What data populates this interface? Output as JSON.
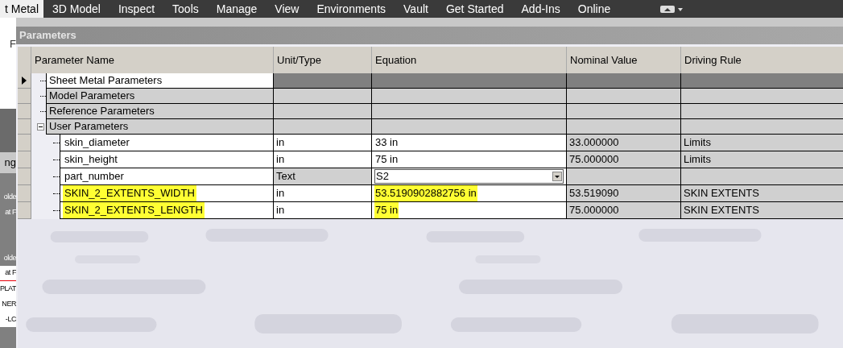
{
  "tabs": [
    {
      "label": "t Metal",
      "selected": true
    },
    {
      "label": "3D Model",
      "selected": false
    },
    {
      "label": "Inspect",
      "selected": false
    },
    {
      "label": "Tools",
      "selected": false
    },
    {
      "label": "Manage",
      "selected": false
    },
    {
      "label": "View",
      "selected": false
    },
    {
      "label": "Environments",
      "selected": false
    },
    {
      "label": "Vault",
      "selected": false
    },
    {
      "label": "Get Started",
      "selected": false
    },
    {
      "label": "Add-Ins",
      "selected": false
    },
    {
      "label": "Online",
      "selected": false
    }
  ],
  "left_panel": {
    "top_text": "F",
    "section_text": "ng",
    "items": [
      {
        "label": "olde",
        "kind": "plain"
      },
      {
        "label": "at F",
        "kind": "plain"
      },
      {
        "label": "olde",
        "kind": "plain"
      },
      {
        "label": "at F",
        "kind": "underlined"
      },
      {
        "label": "PLAT",
        "kind": "plain"
      },
      {
        "label": "NER",
        "kind": "plain"
      },
      {
        "label": "-LC",
        "kind": "plain"
      }
    ]
  },
  "dialog": {
    "title": "Parameters",
    "columns": [
      "Parameter Name",
      "Unit/Type",
      "Equation",
      "Nominal Value",
      "Driving Rule"
    ],
    "groups": [
      {
        "name": "Sheet Metal Parameters",
        "selected": true,
        "current": true
      },
      {
        "name": "Model Parameters",
        "selected": false,
        "current": false
      },
      {
        "name": "Reference Parameters",
        "selected": false,
        "current": false
      },
      {
        "name": "User Parameters",
        "selected": false,
        "current": false,
        "expanded": true,
        "children": [
          {
            "name": "skin_diameter",
            "unit": "in",
            "equation": "33 in",
            "nominal": "33.000000",
            "rule": "Limits",
            "kind": "numeric",
            "highlighted": false
          },
          {
            "name": "skin_height",
            "unit": "in",
            "equation": "75 in",
            "nominal": "75.000000",
            "rule": "Limits",
            "kind": "numeric",
            "highlighted": false
          },
          {
            "name": "part_number",
            "unit": "Text",
            "equation": "S2",
            "kind": "text",
            "highlighted": false
          },
          {
            "name": "SKIN_2_EXTENTS_WIDTH",
            "unit": "in",
            "equation": "53.5190902882756 in",
            "nominal": "53.519090",
            "rule": "SKIN EXTENTS",
            "kind": "numeric",
            "highlighted": true
          },
          {
            "name": "SKIN_2_EXTENTS_LENGTH",
            "unit": "in",
            "equation": "75 in",
            "nominal": "75.000000",
            "rule": "SKIN EXTENTS",
            "kind": "numeric",
            "highlighted": true
          }
        ]
      }
    ]
  }
}
